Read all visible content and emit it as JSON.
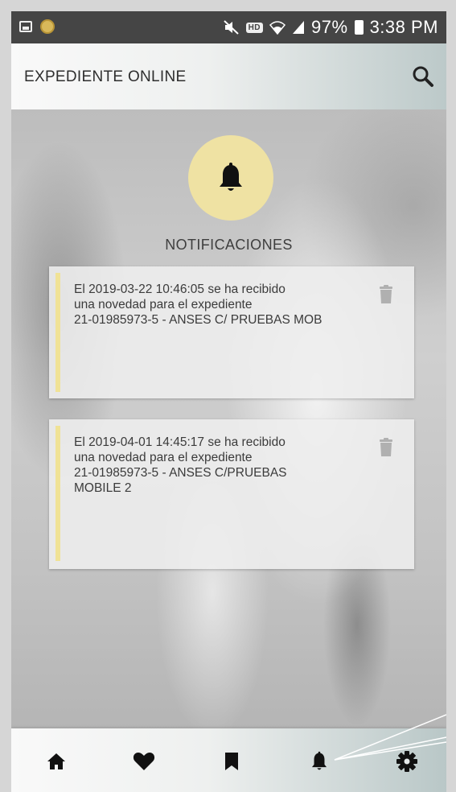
{
  "status_bar": {
    "battery": "97%",
    "time": "3:38 PM",
    "hd_label": "HD",
    "icons": [
      "image-icon",
      "coin-icon",
      "mute-icon",
      "hd-icon",
      "wifi-icon",
      "signal-icon",
      "battery-icon"
    ]
  },
  "app_bar": {
    "title": "EXPEDIENTE ONLINE",
    "action_icon": "search-icon"
  },
  "header": {
    "icon": "bell-icon",
    "title": "NOTIFICACIONES"
  },
  "notifications": [
    {
      "line1": "El 2019-03-22 10:46:05 se ha recibido",
      "line2": "una novedad para el expediente",
      "line3": "21-01985973-5 - ANSES C/ PRUEBAS MOB",
      "line4": "",
      "action_icon": "trash-icon"
    },
    {
      "line1": "El 2019-04-01 14:45:17 se ha recibido",
      "line2": "una novedad para el expediente",
      "line3": "21-01985973-5 - ANSES C/PRUEBAS",
      "line4": "MOBILE 2",
      "action_icon": "trash-icon"
    }
  ],
  "bottom_nav": {
    "items": [
      "home-icon",
      "heart-icon",
      "bookmark-icon",
      "bell-icon",
      "gear-icon"
    ]
  },
  "colors": {
    "accent_yellow": "#f0e296",
    "bell_circle": "#efe2a3",
    "status_bar": "#454545"
  }
}
